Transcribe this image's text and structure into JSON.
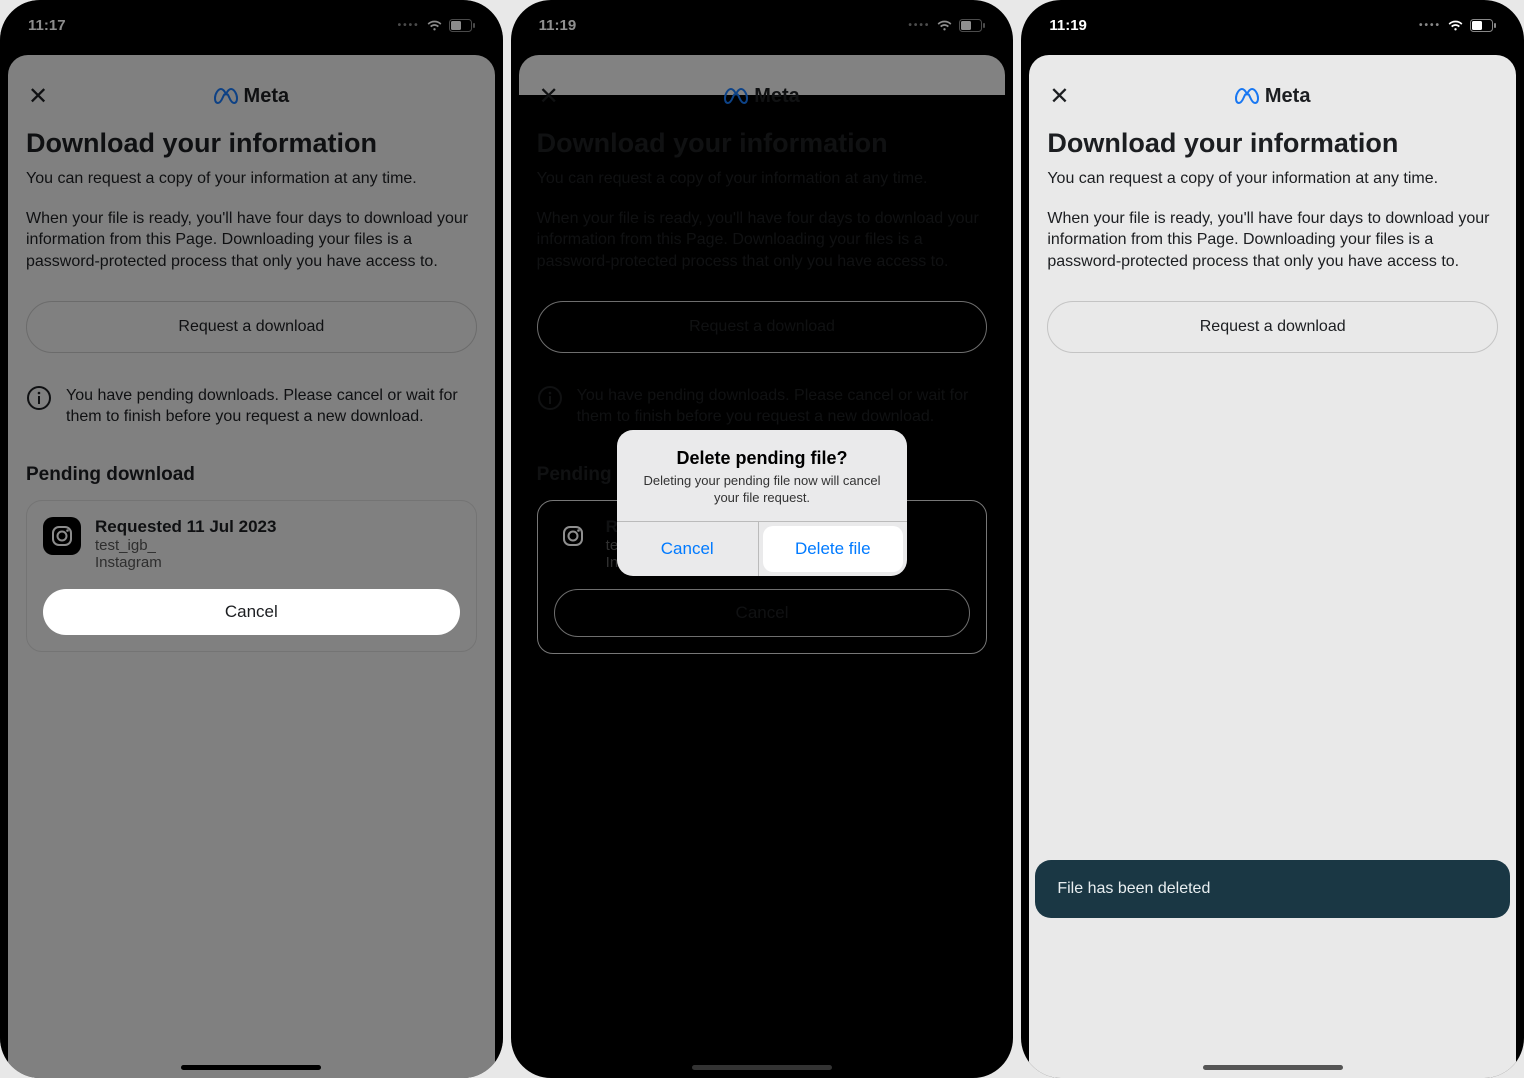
{
  "status": {
    "time1": "11:17",
    "time2": "11:19",
    "time3": "11:19"
  },
  "brand": "Meta",
  "page_title": "Download your information",
  "sub1": "You can request a copy of your information at any time.",
  "sub2": "When your file is ready, you'll have four days to download your information from this Page. Downloading your files is a password-protected process that only you have access to.",
  "request_btn": "Request a download",
  "info_text": "You have pending downloads. Please cancel or wait for them to finish before you request a new download.",
  "section_label": "Pending download",
  "pending": {
    "title": "Requested 11 Jul 2023",
    "user": "test_igb_",
    "platform": "Instagram",
    "cancel": "Cancel"
  },
  "alert": {
    "title": "Delete pending file?",
    "msg": "Deleting your pending file now will cancel your file request.",
    "cancel": "Cancel",
    "confirm": "Delete file"
  },
  "toast": "File has been deleted"
}
